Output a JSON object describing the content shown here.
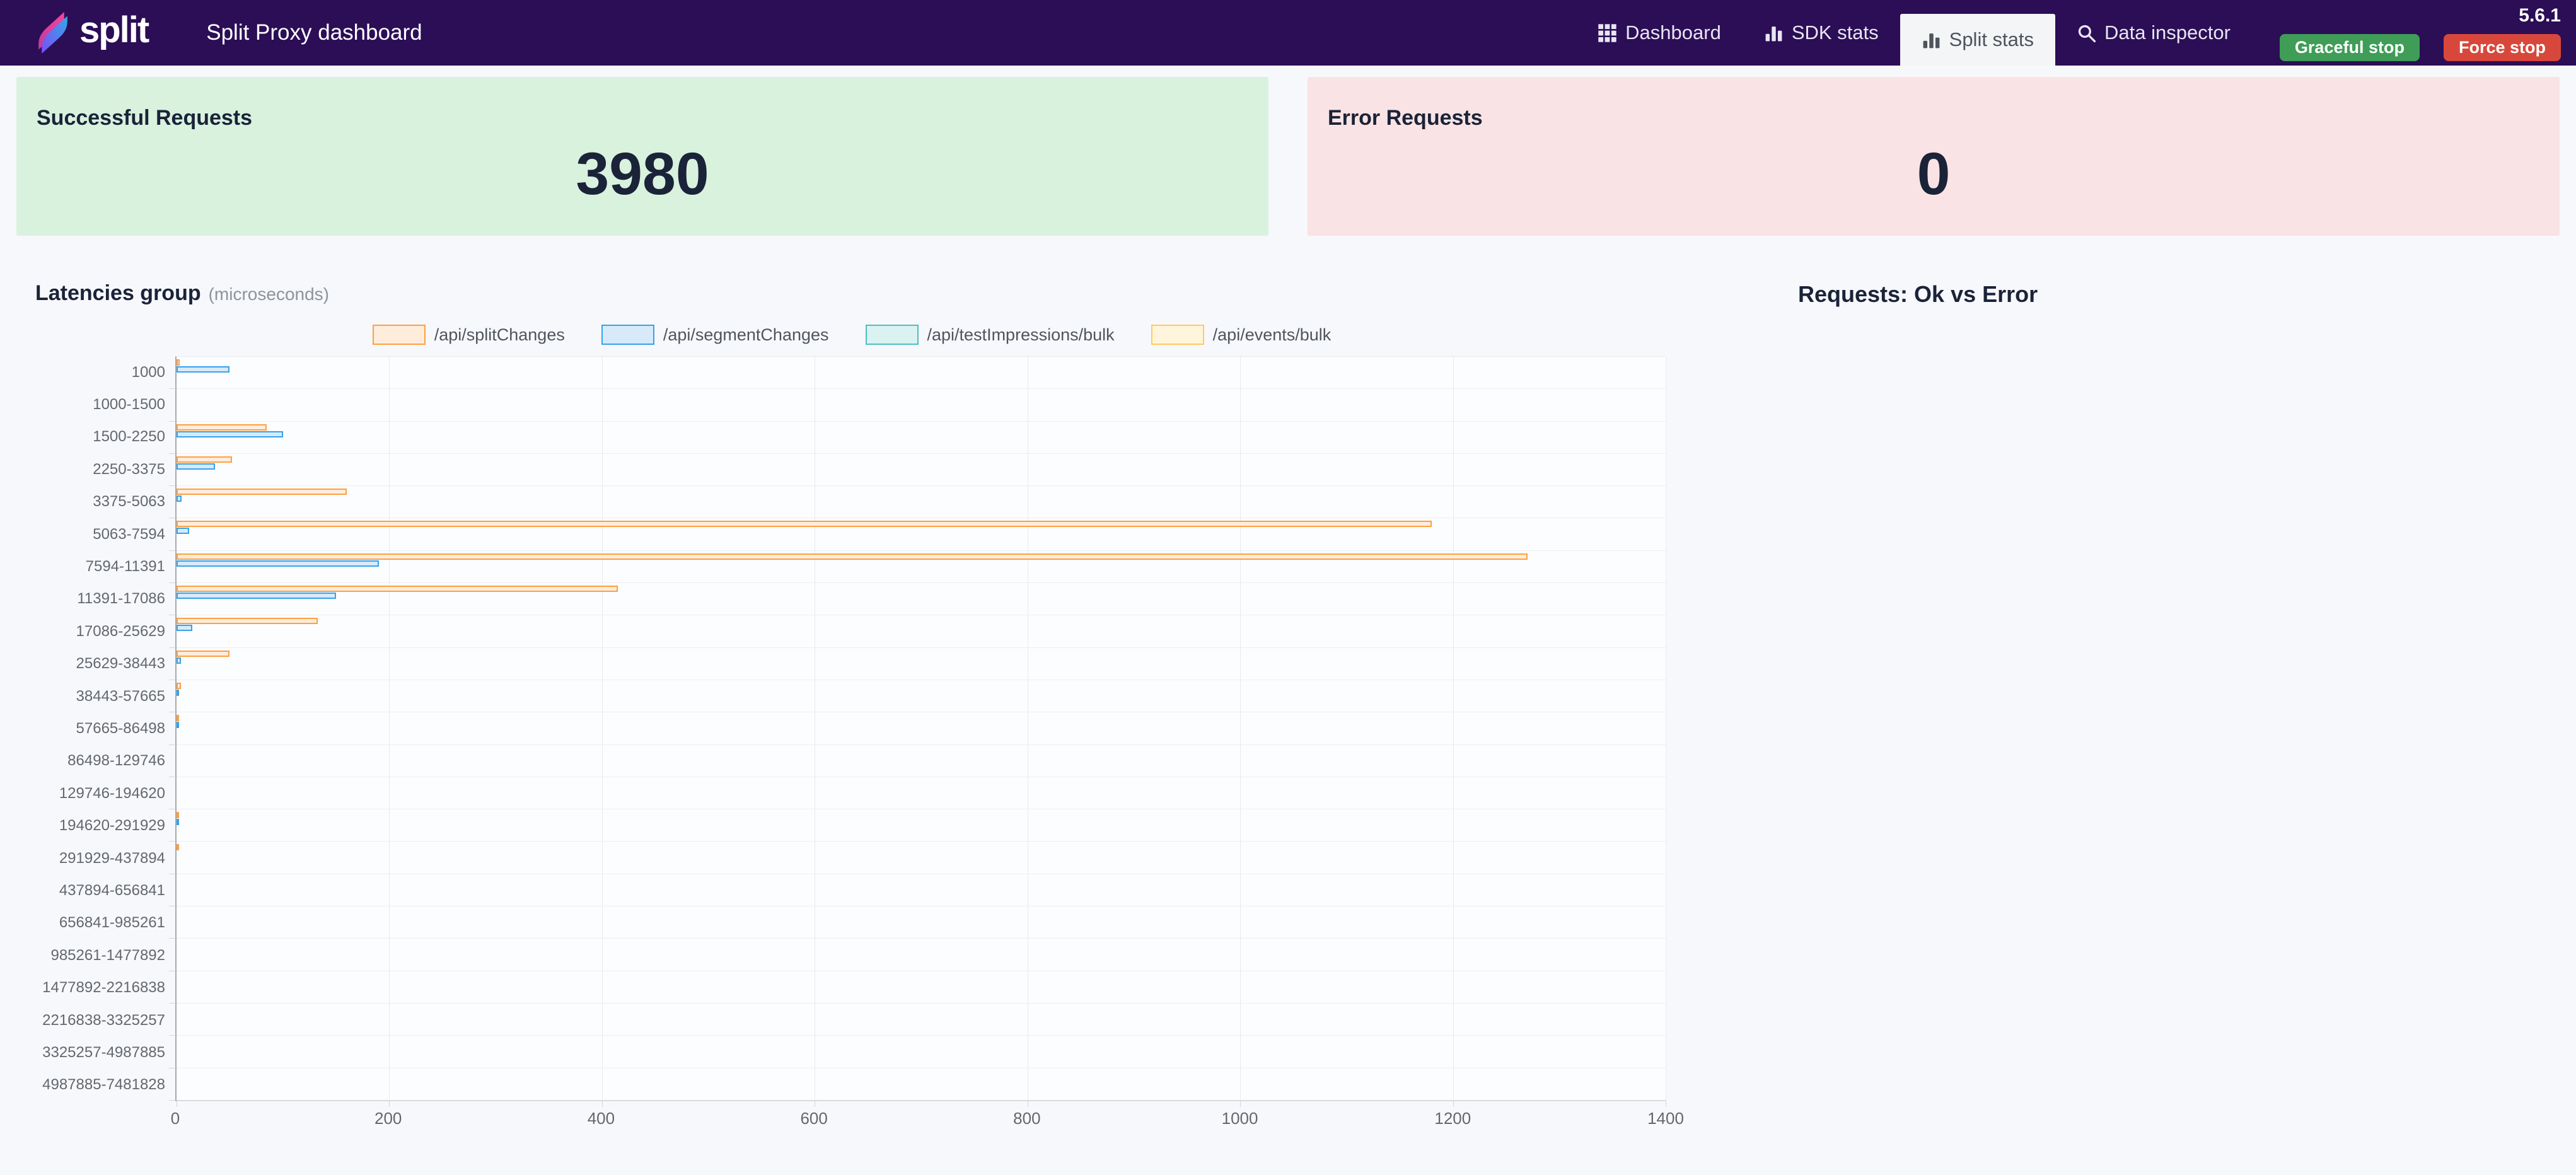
{
  "navbar": {
    "brand": "split",
    "title": "Split Proxy dashboard",
    "items": [
      {
        "label": "Dashboard",
        "icon": "grid-icon",
        "active": false
      },
      {
        "label": "SDK stats",
        "icon": "bar-chart-icon",
        "active": false
      },
      {
        "label": "Split stats",
        "icon": "bar-chart-icon",
        "active": true
      },
      {
        "label": "Data inspector",
        "icon": "search-icon",
        "active": false
      }
    ],
    "version": "5.6.1",
    "actions": {
      "graceful": "Graceful stop",
      "force": "Force stop"
    },
    "colors": {
      "navbar_bg": "#2B0E56",
      "graceful_bg": "#3F9D57",
      "force_bg": "#D8473B"
    }
  },
  "cards": {
    "success": {
      "title": "Successful Requests",
      "value": "3980",
      "bg": "#D9F2DE"
    },
    "error": {
      "title": "Error Requests",
      "value": "0",
      "bg": "#FAE3E4"
    }
  },
  "latencies": {
    "title": "Latencies group",
    "subtitle": "(microseconds)"
  },
  "requests_chart": {
    "title": "Requests: Ok vs Error"
  },
  "chart_data": {
    "type": "bar",
    "orientation": "horizontal",
    "title": "Latencies group (microseconds)",
    "legend_position": "top",
    "grid": true,
    "xlim": [
      0,
      1400
    ],
    "x_ticks": [
      0,
      200,
      400,
      600,
      800,
      1000,
      1200,
      1400
    ],
    "categories": [
      "1000",
      "1000-1500",
      "1500-2250",
      "2250-3375",
      "3375-5063",
      "5063-7594",
      "7594-11391",
      "11391-17086",
      "17086-25629",
      "25629-38443",
      "38443-57665",
      "57665-86498",
      "86498-129746",
      "129746-194620",
      "194620-291929",
      "291929-437894",
      "437894-656841",
      "656841-985261",
      "985261-1477892",
      "1477892-2216838",
      "2216838-3325257",
      "3325257-4987885",
      "4987885-7481828"
    ],
    "series": [
      {
        "name": "/api/splitChanges",
        "color": "#FF9F40",
        "fill": "#FFECDA",
        "values": [
          3,
          0,
          85,
          52,
          160,
          1180,
          1270,
          415,
          133,
          50,
          4,
          2,
          0,
          0,
          1,
          1,
          0,
          0,
          0,
          0,
          0,
          0,
          0
        ]
      },
      {
        "name": "/api/segmentChanges",
        "color": "#36A2EB",
        "fill": "#D6EAFA",
        "values": [
          50,
          0,
          100,
          36,
          5,
          12,
          190,
          150,
          15,
          4,
          1,
          1,
          0,
          0,
          1,
          0,
          0,
          0,
          0,
          0,
          0,
          0,
          0
        ]
      },
      {
        "name": "/api/testImpressions/bulk",
        "color": "#4BC0C0",
        "fill": "#DBF2F2",
        "values": [
          0,
          0,
          0,
          0,
          0,
          0,
          0,
          0,
          0,
          0,
          0,
          0,
          0,
          0,
          0,
          0,
          0,
          0,
          0,
          0,
          0,
          0,
          0
        ]
      },
      {
        "name": "/api/events/bulk",
        "color": "#FFCD56",
        "fill": "#FFF5DC",
        "values": [
          0,
          0,
          0,
          0,
          0,
          0,
          0,
          0,
          0,
          0,
          0,
          0,
          0,
          0,
          0,
          0,
          0,
          0,
          0,
          0,
          0,
          0,
          0
        ]
      }
    ]
  }
}
